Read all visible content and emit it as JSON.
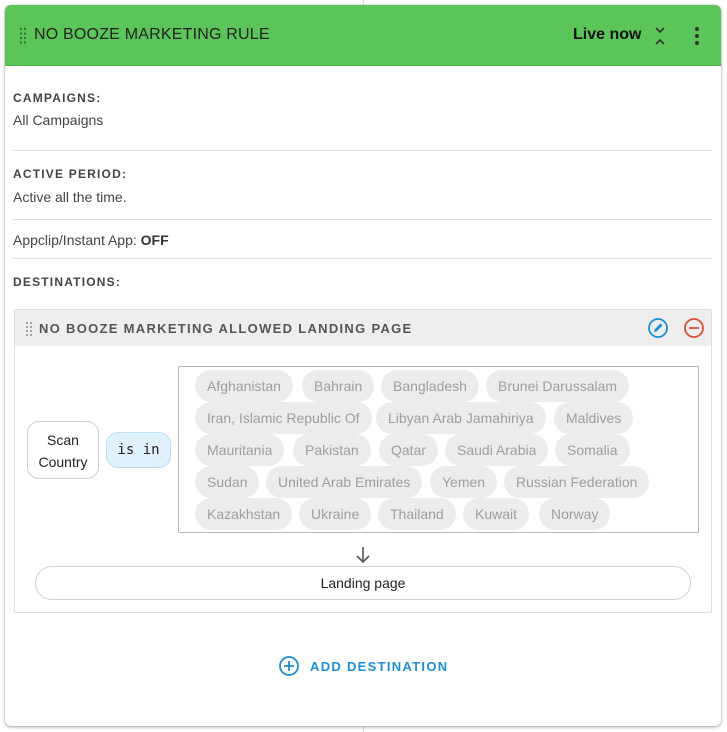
{
  "rule": {
    "title": "NO BOOZE MARKETING RULE",
    "status": "Live now"
  },
  "campaigns": {
    "label": "CAMPAIGNS:",
    "value": "All Campaigns"
  },
  "active_period": {
    "label": "ACTIVE PERIOD:",
    "value": "Active all the time."
  },
  "appclip": {
    "label": "Appclip/Instant App:",
    "value": "OFF"
  },
  "destinations": {
    "label": "DESTINATIONS:",
    "items": [
      {
        "title": "NO BOOZE MARKETING ALLOWED LANDING PAGE",
        "condition": {
          "field_line1": "Scan",
          "field_line2": "Country",
          "operator": "is in",
          "countries": [
            "Afghanistan",
            "Bahrain",
            "Bangladesh",
            "Brunei Darussalam",
            "Iran, Islamic Republic Of",
            "Libyan Arab Jamahiriya",
            "Maldives",
            "Mauritania",
            "Pakistan",
            "Qatar",
            "Saudi Arabia",
            "Somalia",
            "Sudan",
            "United Arab Emirates",
            "Yemen",
            "Russian Federation",
            "Kazakhstan",
            "Ukraine",
            "Thailand",
            "Kuwait",
            "Norway"
          ]
        },
        "target": "Landing page"
      }
    ],
    "add_label": "ADD DESTINATION"
  },
  "colors": {
    "header_bg": "#5cc55a",
    "accent_blue": "#1d8fd6",
    "remove_red": "#e04b3c"
  },
  "icons": {
    "drag": "drag-handle-icon",
    "collapse": "collapse-icon",
    "menu": "more-vertical-icon",
    "edit": "edit-pencil-icon",
    "remove": "remove-circle-icon",
    "arrow": "arrow-down-icon",
    "add": "add-circle-icon"
  }
}
